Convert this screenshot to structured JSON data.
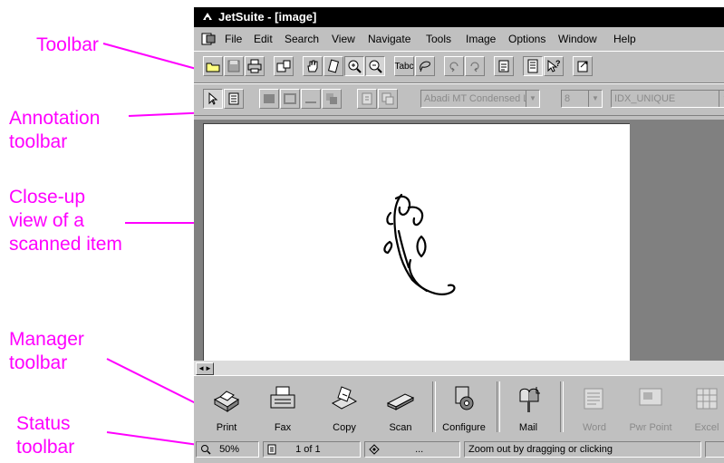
{
  "window": {
    "title": "JetSuite - [image]"
  },
  "menu": [
    "File",
    "Edit",
    "Search",
    "View",
    "Navigate",
    "Tools",
    "Image",
    "Options",
    "Window",
    "Help"
  ],
  "callouts": {
    "toolbar": "Toolbar",
    "annotation": "Annotation\ntoolbar",
    "closeup": "Close-up\nview of a\nscanned item",
    "manager": "Manager\ntoolbar",
    "status": "Status\ntoolbar"
  },
  "toolbar": {
    "icons": [
      "open-folder-icon",
      "save-icon",
      "print-icon",
      "scan-to-image-icon",
      "hand-pan-icon",
      "rotate-page-icon",
      "zoom-in-icon",
      "zoom-out-icon",
      "ocr-text-icon",
      "lasso-select-icon",
      "rotate-left-icon",
      "rotate-right-icon",
      "find-icon",
      "page-view-icon",
      "help-pointer-icon",
      "export-icon"
    ],
    "ocr_label": "Tabc"
  },
  "annotation": {
    "font_name": "Abadi MT Condensed L",
    "font_size": "8",
    "style": "IDX_UNIQUE"
  },
  "manager": {
    "buttons": [
      {
        "label": "Print",
        "icon": "printer-icon",
        "enabled": true
      },
      {
        "label": "Fax",
        "icon": "fax-icon",
        "enabled": true
      },
      {
        "label": "Copy",
        "icon": "copy-icon",
        "enabled": true
      },
      {
        "label": "Scan",
        "icon": "scanner-icon",
        "enabled": true
      },
      {
        "label": "Configure",
        "icon": "configure-icon",
        "enabled": true
      },
      {
        "label": "Mail",
        "icon": "mailbox-icon",
        "enabled": true
      },
      {
        "label": "Word",
        "icon": "word-icon",
        "enabled": false
      },
      {
        "label": "Pwr Point",
        "icon": "powerpoint-icon",
        "enabled": false
      },
      {
        "label": "Excel",
        "icon": "excel-icon",
        "enabled": false
      }
    ]
  },
  "status": {
    "zoom": "50%",
    "page": "1 of 1",
    "ellipsis": "...",
    "message": "Zoom out by dragging or clicking"
  },
  "colors": {
    "callout": "#ff00ff",
    "titlebar": "#000000",
    "face": "#c0c0c0",
    "workspace": "#808080"
  }
}
